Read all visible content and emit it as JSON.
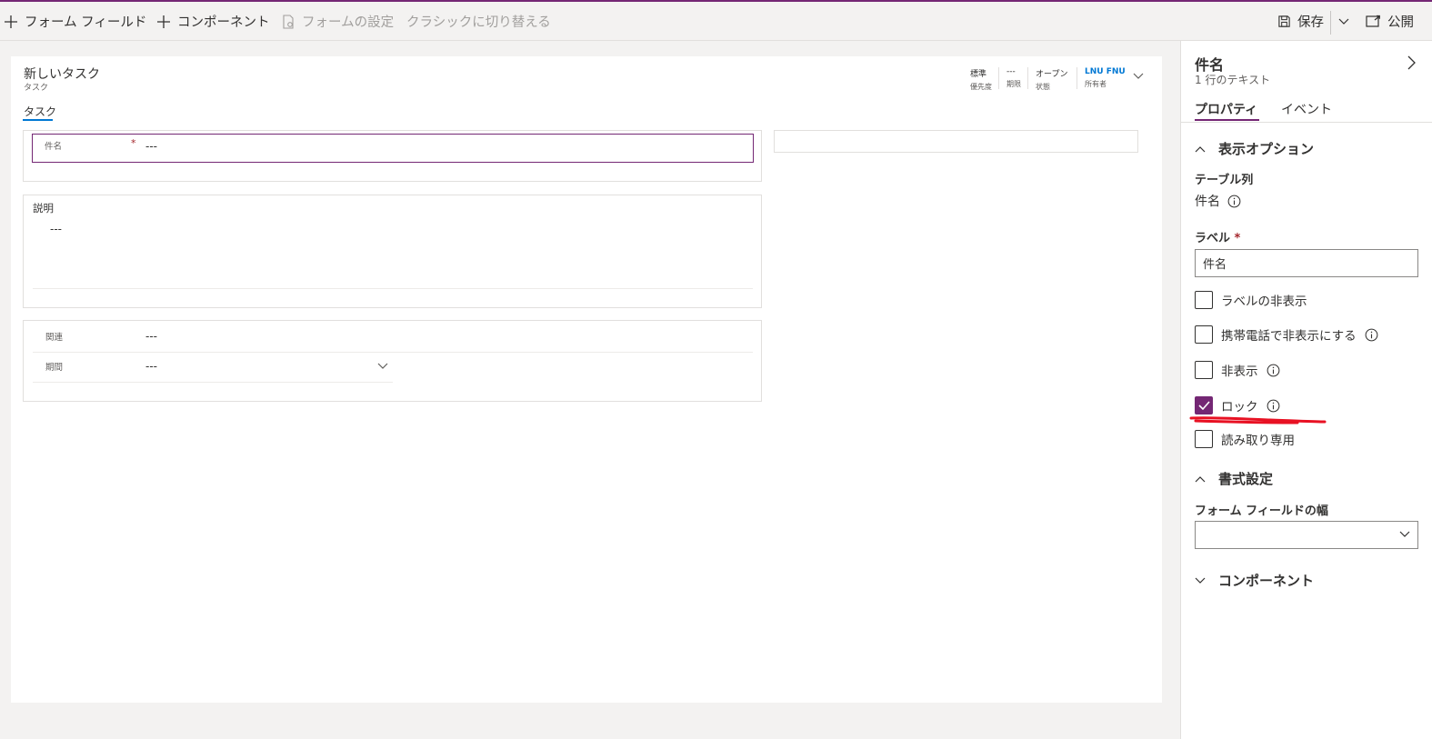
{
  "toolbar": {
    "form_field": "フォーム フィールド",
    "component": "コンポーネント",
    "form_settings": "フォームの設定",
    "switch_classic": "クラシックに切り替える",
    "save": "保存",
    "publish": "公開"
  },
  "form": {
    "title": "新しいタスク",
    "subtitle": "タスク",
    "header_fields": [
      {
        "value": "標準",
        "label": "優先度"
      },
      {
        "value": "---",
        "label": "期限"
      },
      {
        "value": "オープン",
        "label": "状態"
      },
      {
        "value": "LNU FNU",
        "label": "所有者"
      }
    ],
    "tab": "タスク",
    "subject": {
      "label": "件名",
      "required": "*",
      "value": "---"
    },
    "description": {
      "label": "説明",
      "value": "---"
    },
    "regarding": {
      "label": "関連",
      "value": "---"
    },
    "duration": {
      "label": "期間",
      "value": "---"
    }
  },
  "panel": {
    "title": "件名",
    "subtitle": "1 行のテキスト",
    "tabs": [
      "プロパティ",
      "イベント"
    ],
    "display_options": "表示オプション",
    "table_column_label": "テーブル列",
    "table_column_value": "件名",
    "label_field_label": "ラベル",
    "label_required": "*",
    "label_value": "件名",
    "checkboxes": [
      {
        "label": "ラベルの非表示",
        "checked": false
      },
      {
        "label": "携帯電話で非表示にする",
        "checked": false
      },
      {
        "label": "非表示",
        "checked": false
      },
      {
        "label": "ロック",
        "checked": true
      },
      {
        "label": "読み取り専用",
        "checked": false
      }
    ],
    "format_settings": "書式設定",
    "form_field_width": "フォーム フィールドの幅",
    "components": "コンポーネント"
  },
  "colors": {
    "accent": "#742774",
    "annotation": "#e81123",
    "link": "#0078d4"
  }
}
